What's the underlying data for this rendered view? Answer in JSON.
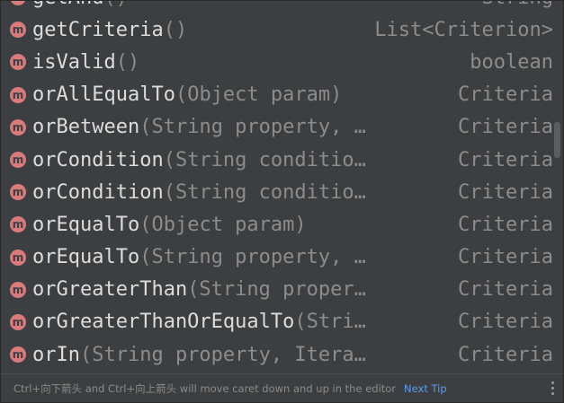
{
  "items": [
    {
      "badge": "m",
      "name": "getAnd",
      "params": "()",
      "ret": "String"
    },
    {
      "badge": "m",
      "name": "getCriteria",
      "params": "()",
      "ret": "List<Criterion>"
    },
    {
      "badge": "m",
      "name": "isValid",
      "params": "()",
      "ret": "boolean"
    },
    {
      "badge": "m",
      "name": "orAllEqualTo",
      "params": "(Object param)",
      "ret": "Criteria"
    },
    {
      "badge": "m",
      "name": "orBetween",
      "params": "(String property, …",
      "ret": "Criteria"
    },
    {
      "badge": "m",
      "name": "orCondition",
      "params": "(String conditio…",
      "ret": "Criteria"
    },
    {
      "badge": "m",
      "name": "orCondition",
      "params": "(String conditio…",
      "ret": "Criteria"
    },
    {
      "badge": "m",
      "name": "orEqualTo",
      "params": "(Object param)",
      "ret": "Criteria"
    },
    {
      "badge": "m",
      "name": "orEqualTo",
      "params": "(String property, …",
      "ret": "Criteria"
    },
    {
      "badge": "m",
      "name": "orGreaterThan",
      "params": "(String proper…",
      "ret": "Criteria"
    },
    {
      "badge": "m",
      "name": "orGreaterThanOrEqualTo",
      "params": "(Stri…",
      "ret": "Criteria"
    },
    {
      "badge": "m",
      "name": "orIn",
      "params": "(String property, Itera…",
      "ret": "Criteria"
    }
  ],
  "footer": {
    "hint": "Ctrl+向下箭头 and Ctrl+向上箭头 will move caret down and up in the editor",
    "next_tip": "Next Tip"
  },
  "icons": {
    "method_badge": "method-icon",
    "more": "vertical-ellipsis-icon"
  },
  "colors": {
    "background": "#3c3f41",
    "method_name": "#dcdcdc",
    "params": "#8c8c8c",
    "badge": "#d97a7c",
    "link": "#589df6"
  }
}
